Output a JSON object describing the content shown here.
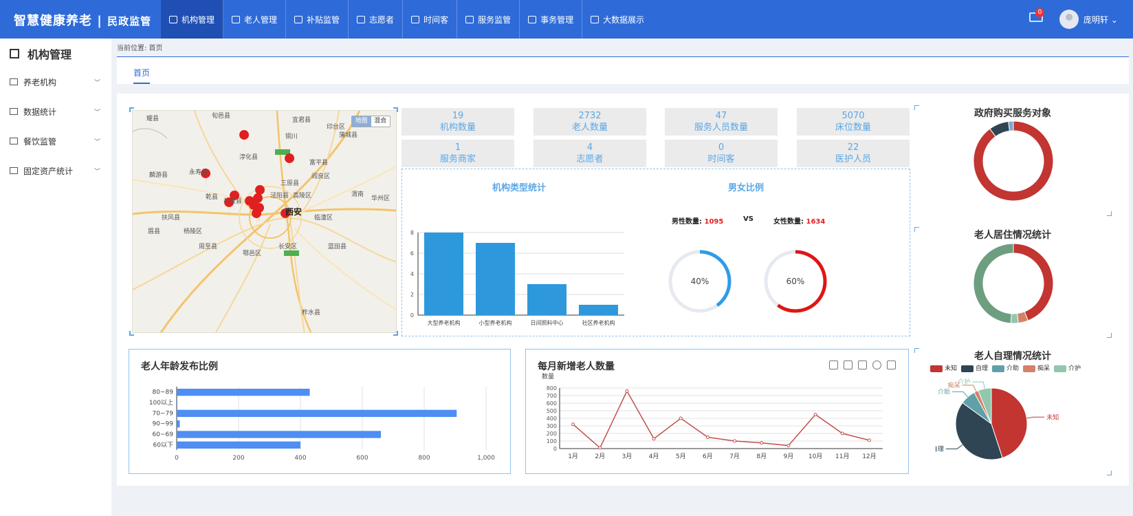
{
  "header": {
    "brand": "智慧健康养老",
    "brand_sub": "民政监管",
    "badge": "0",
    "user": "庞明轩 ⌄",
    "nav": [
      {
        "label": "机构管理"
      },
      {
        "label": "老人管理"
      },
      {
        "label": "补贴监管"
      },
      {
        "label": "志愿者"
      },
      {
        "label": "时间客"
      },
      {
        "label": "服务监管"
      },
      {
        "label": "事务管理"
      },
      {
        "label": "大数据展示"
      }
    ]
  },
  "sidebar": {
    "title": "机构管理",
    "items": [
      {
        "label": "养老机构"
      },
      {
        "label": "数据统计"
      },
      {
        "label": "餐饮监管"
      },
      {
        "label": "固定资产统计"
      }
    ]
  },
  "breadcrumb": "当前位置: 首页",
  "tab": "首页",
  "map": {
    "toggle_map": "地图",
    "toggle_hybrid": "混合",
    "labels": [
      "耀县",
      "旬邑县",
      "宜君县",
      "印台区",
      "铜川",
      "淳化县",
      "王益区",
      "蒲城县",
      "富平县",
      "麟游县",
      "永寿县",
      "三原县",
      "阎良区",
      "渭南",
      "乾县",
      "泾阳县",
      "高陵区",
      "扶风县",
      "礼泉县",
      "咸阳",
      "秦都区",
      "西安",
      "临潼区",
      "华州区",
      "眉县",
      "杨陵区",
      "周至县",
      "鄠邑区",
      "长安区",
      "蓝田县",
      "柞水县",
      "柞水县"
    ]
  },
  "stats": [
    {
      "value": "19",
      "label": "机构数量"
    },
    {
      "value": "2732",
      "label": "老人数量"
    },
    {
      "value": "47",
      "label": "服务人员数量"
    },
    {
      "value": "5070",
      "label": "床位数量"
    },
    {
      "value": "1",
      "label": "服务商家"
    },
    {
      "value": "4",
      "label": "志愿者"
    },
    {
      "value": "0",
      "label": "时间客"
    },
    {
      "value": "22",
      "label": "医护人员"
    }
  ],
  "sections": {
    "type_title": "机构类型统计",
    "gender_title": "男女比例"
  },
  "gender": {
    "male_label": "男性数量:",
    "male_value": "1095",
    "vs": "VS",
    "female_label": "女性数量:",
    "female_value": "1634",
    "male_pct": 40,
    "female_pct": 60,
    "male_pct_label": "40%",
    "female_pct_label": "60%",
    "male_color": "#2e9ce8",
    "female_color": "#e01515"
  },
  "panels": {
    "age_title": "老人年龄发布比例",
    "monthly_title": "每月新增老人数量",
    "monthly_ylabel": "数量",
    "gov_title": "政府购买服务对象",
    "living_title": "老人居住情况统计",
    "self_title": "老人自理情况统计"
  },
  "chart_data": [
    {
      "type": "bar",
      "title": "机构类型统计",
      "categories": [
        "大型养老机构",
        "小型养老机构",
        "日间照料中心",
        "社区养老机构"
      ],
      "values": [
        8,
        7,
        3,
        1
      ],
      "ylim": [
        0,
        8
      ],
      "yticks": [
        0,
        2,
        4,
        6,
        8
      ],
      "color": "#2e98dc"
    },
    {
      "type": "bar",
      "orientation": "horizontal",
      "title": "老人年龄发布比例",
      "categories": [
        "80~89",
        "100以上",
        "70~79",
        "90~99",
        "60~69",
        "60以下"
      ],
      "values": [
        430,
        2,
        905,
        10,
        660,
        400
      ],
      "xlim": [
        0,
        1000
      ],
      "xticks": [
        "0",
        "200",
        "400",
        "600",
        "800",
        "1,000"
      ],
      "color": "#4f8ef2"
    },
    {
      "type": "line",
      "title": "每月新增老人数量",
      "categories": [
        "1月",
        "2月",
        "3月",
        "4月",
        "5月",
        "6月",
        "7月",
        "8月",
        "9月",
        "10月",
        "11月",
        "12月"
      ],
      "values": [
        320,
        10,
        760,
        130,
        400,
        150,
        100,
        75,
        40,
        450,
        200,
        110
      ],
      "ylim": [
        0,
        800
      ],
      "yticks": [
        0,
        100,
        200,
        300,
        400,
        500,
        600,
        700,
        800
      ],
      "ylabel": "数量",
      "color": "#c0504d"
    },
    {
      "type": "pie",
      "title": "政府购买服务对象",
      "donut": true,
      "values": [
        90,
        8,
        2
      ],
      "colors": [
        "#c23531",
        "#2f4554",
        "#7fa8c9"
      ]
    },
    {
      "type": "pie",
      "title": "老人居住情况统计",
      "donut": true,
      "values": [
        44,
        4,
        3,
        49
      ],
      "colors": [
        "#c23531",
        "#d48265",
        "#91c7ae",
        "#6e9e80"
      ]
    },
    {
      "type": "pie",
      "title": "老人自理情况统计",
      "series": [
        {
          "name": "未知",
          "value": 45
        },
        {
          "name": "自理",
          "value": 40
        },
        {
          "name": "介助",
          "value": 7
        },
        {
          "name": "痴呆",
          "value": 2
        },
        {
          "name": "介护",
          "value": 6
        }
      ],
      "colors": [
        "#c23531",
        "#2f4554",
        "#61a0a8",
        "#d48265",
        "#91c7ae"
      ]
    }
  ]
}
